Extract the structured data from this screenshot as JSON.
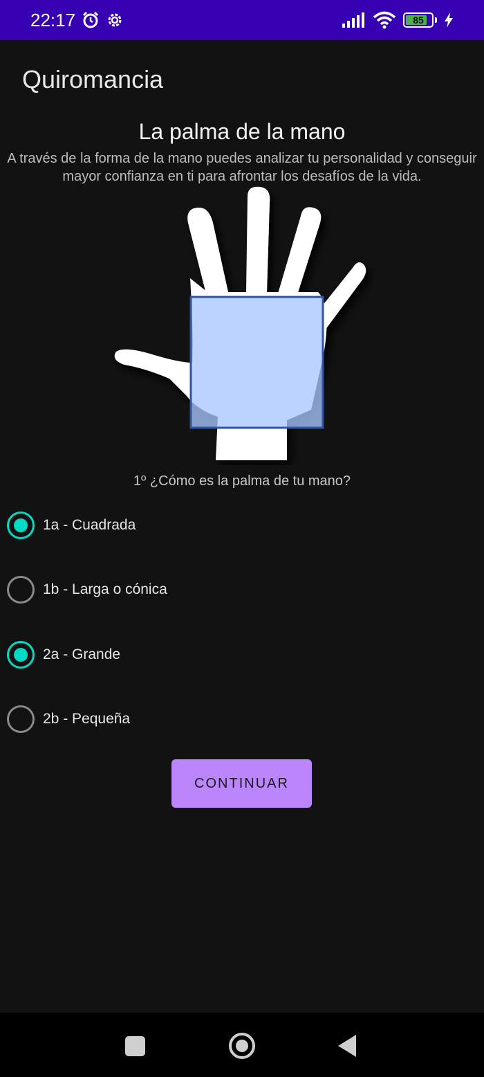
{
  "status_bar": {
    "time": "22:17",
    "battery_level": "85",
    "icons": [
      "alarm-icon",
      "settings-icon",
      "signal-icon",
      "wifi-icon",
      "battery-icon",
      "charging-icon"
    ],
    "color": "#3700b3"
  },
  "app": {
    "title": "Quiromancia"
  },
  "section": {
    "title": "La palma de la mano",
    "description": "A través de la forma de la mano puedes analizar tu personalidad y conseguir mayor confianza en ti para afrontar los desafíos de la vida."
  },
  "question": {
    "text": "1º ¿Cómo es la palma de tu mano?"
  },
  "options": [
    {
      "label": "1a - Cuadrada",
      "checked": true
    },
    {
      "label": "1b - Larga o cónica",
      "checked": false
    },
    {
      "label": "2a - Grande",
      "checked": true
    },
    {
      "label": "2b - Pequeña",
      "checked": false
    }
  ],
  "button": {
    "label": "CONTINUAR",
    "color": "#bb86fc"
  },
  "accent_color": "#03dac5",
  "nav": {
    "icons": [
      "recents-icon",
      "home-icon",
      "back-icon"
    ]
  }
}
